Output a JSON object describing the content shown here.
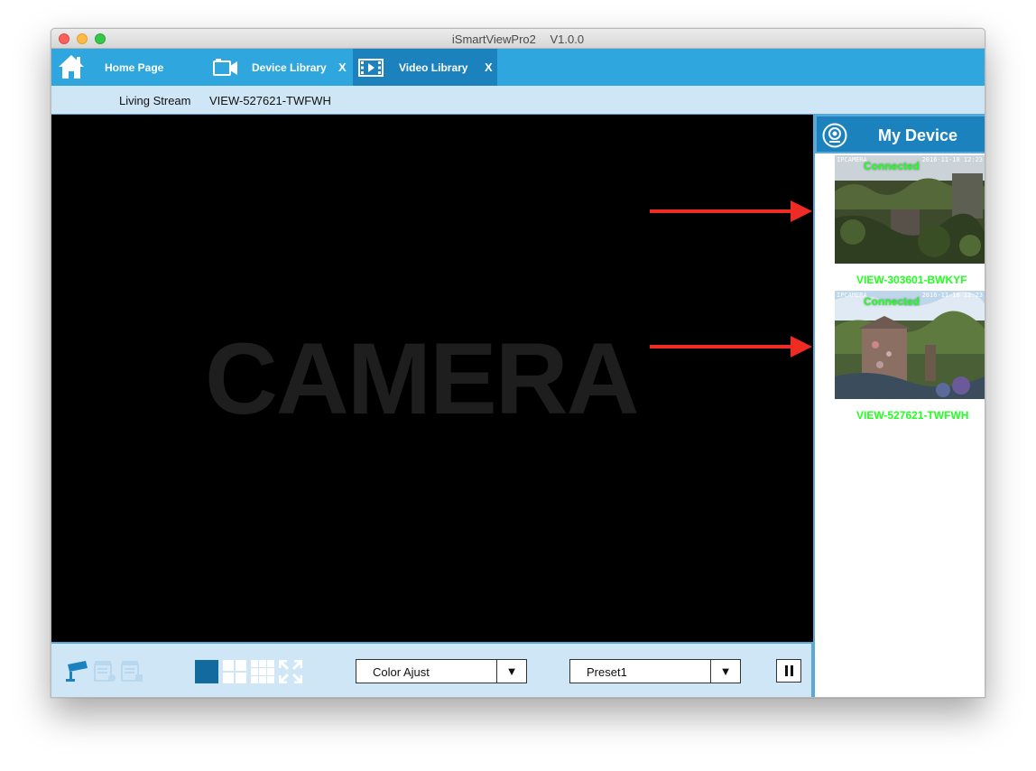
{
  "window": {
    "title": "iSmartViewPro2",
    "version": "V1.0.0"
  },
  "tabs": [
    {
      "label": "Home Page",
      "icon": "home-icon",
      "closable": false
    },
    {
      "label": "Device Library",
      "icon": "camera-icon",
      "close": "X"
    },
    {
      "label": "Video Library",
      "icon": "film-icon",
      "close": "X",
      "active": true
    }
  ],
  "stream": {
    "label": "Living Stream",
    "name": "VIEW-527621-TWFWH"
  },
  "video": {
    "watermark": "CAMERA"
  },
  "controls": {
    "left_icons": [
      "surveillance-camera-icon",
      "record-list-icon",
      "snapshot-list-icon"
    ],
    "layout_icons": [
      "single-view-icon",
      "quad-view-icon",
      "nine-view-icon",
      "fullscreen-icon"
    ],
    "color_select": {
      "value": "Color Ajust",
      "arrow": "▼"
    },
    "preset_select": {
      "value": "Preset1",
      "arrow": "▼"
    },
    "pause": "pause-icon"
  },
  "sidebar": {
    "title": "My Device",
    "devices": [
      {
        "status": "Connected",
        "name": "VIEW-303601-BWKYF",
        "osd_left": "IPCAMERA",
        "osd_right": "2016-11-18 12:23"
      },
      {
        "status": "Connected",
        "name": "VIEW-527621-TWFWH",
        "osd_left": "IPCAMERA",
        "osd_right": "2016-11-18 12:23"
      }
    ]
  },
  "colors": {
    "tabbar": "#2fa6dd",
    "active_tab": "#1c82bd",
    "status_green": "#22ff22",
    "annotation_arrow": "#ee2b24"
  }
}
